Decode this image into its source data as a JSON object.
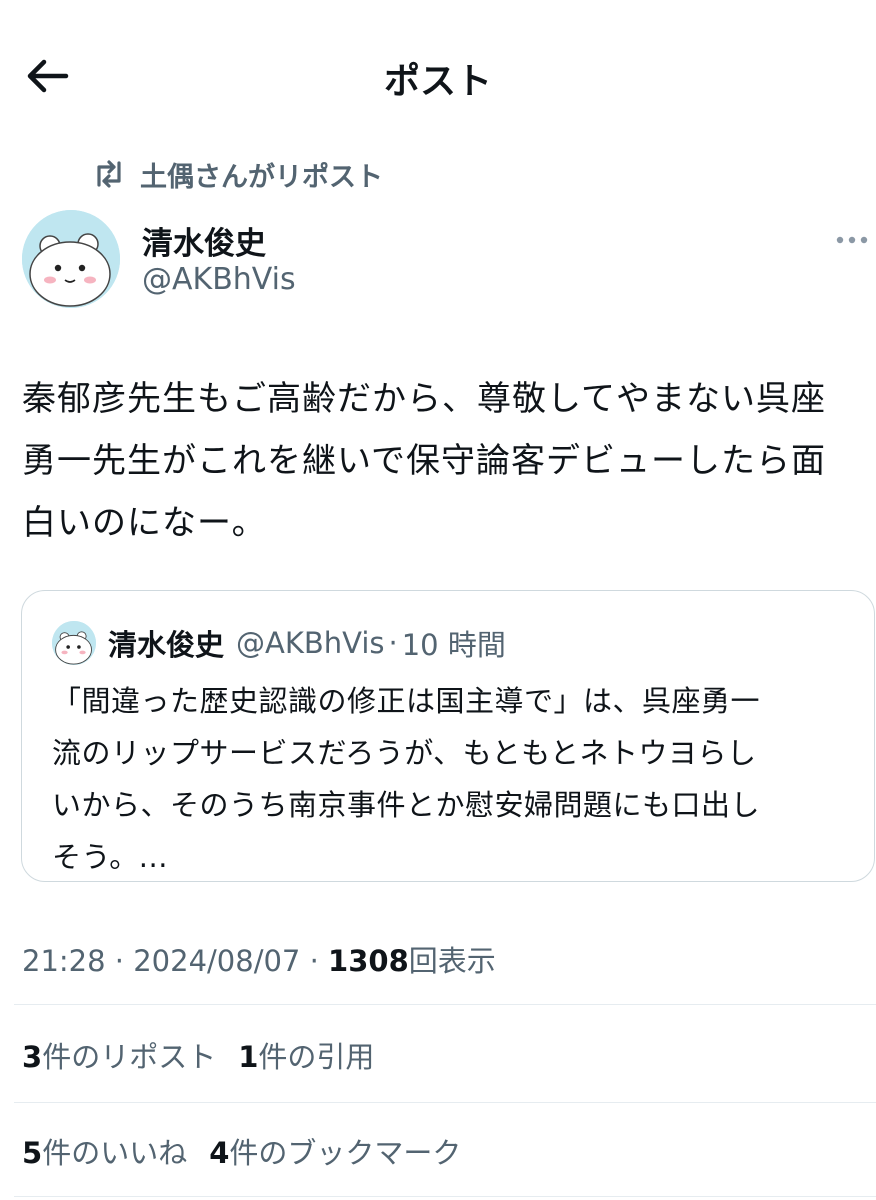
{
  "header": {
    "title": "ポスト",
    "back_icon": "arrow-left-icon"
  },
  "repost_context": {
    "text": "土偶さんがリポスト",
    "icon": "repost-icon"
  },
  "author": {
    "name": "清水俊史",
    "handle": "@AKBhVis"
  },
  "tweet": {
    "lines": [
      "秦郁彦先生もご高齢だから、尊敬してやまない呉座",
      "勇一先生がこれを継いで保守論客デビューしたら面",
      "白いのになー。"
    ]
  },
  "quote": {
    "name": "清水俊史",
    "handle": "@AKBhVis",
    "separator": "·",
    "time": "10 時間",
    "lines": [
      "「間違った歴史認識の修正は国主導で」は、呉座勇一",
      "流のリップサービスだろうが、もともとネトウヨらし",
      "いから、そのうち南京事件とか慰安婦問題にも口出し",
      "そう。..."
    ]
  },
  "meta": {
    "time": "21:28",
    "date": "2024/08/07",
    "separator": " · ",
    "views": "1308",
    "views_label": "回表示"
  },
  "stats": {
    "reposts": "3",
    "reposts_label": "件のリポスト",
    "quotes": "1",
    "quotes_label": "件の引用",
    "likes": "5",
    "likes_label": "件のいいね",
    "bookmarks": "4",
    "bookmarks_label": "件のブックマーク"
  },
  "colors": {
    "text": "#0f1419",
    "secondary": "#536471",
    "border": "#cfd9de",
    "avatar_bg": "#bfe6f0"
  }
}
